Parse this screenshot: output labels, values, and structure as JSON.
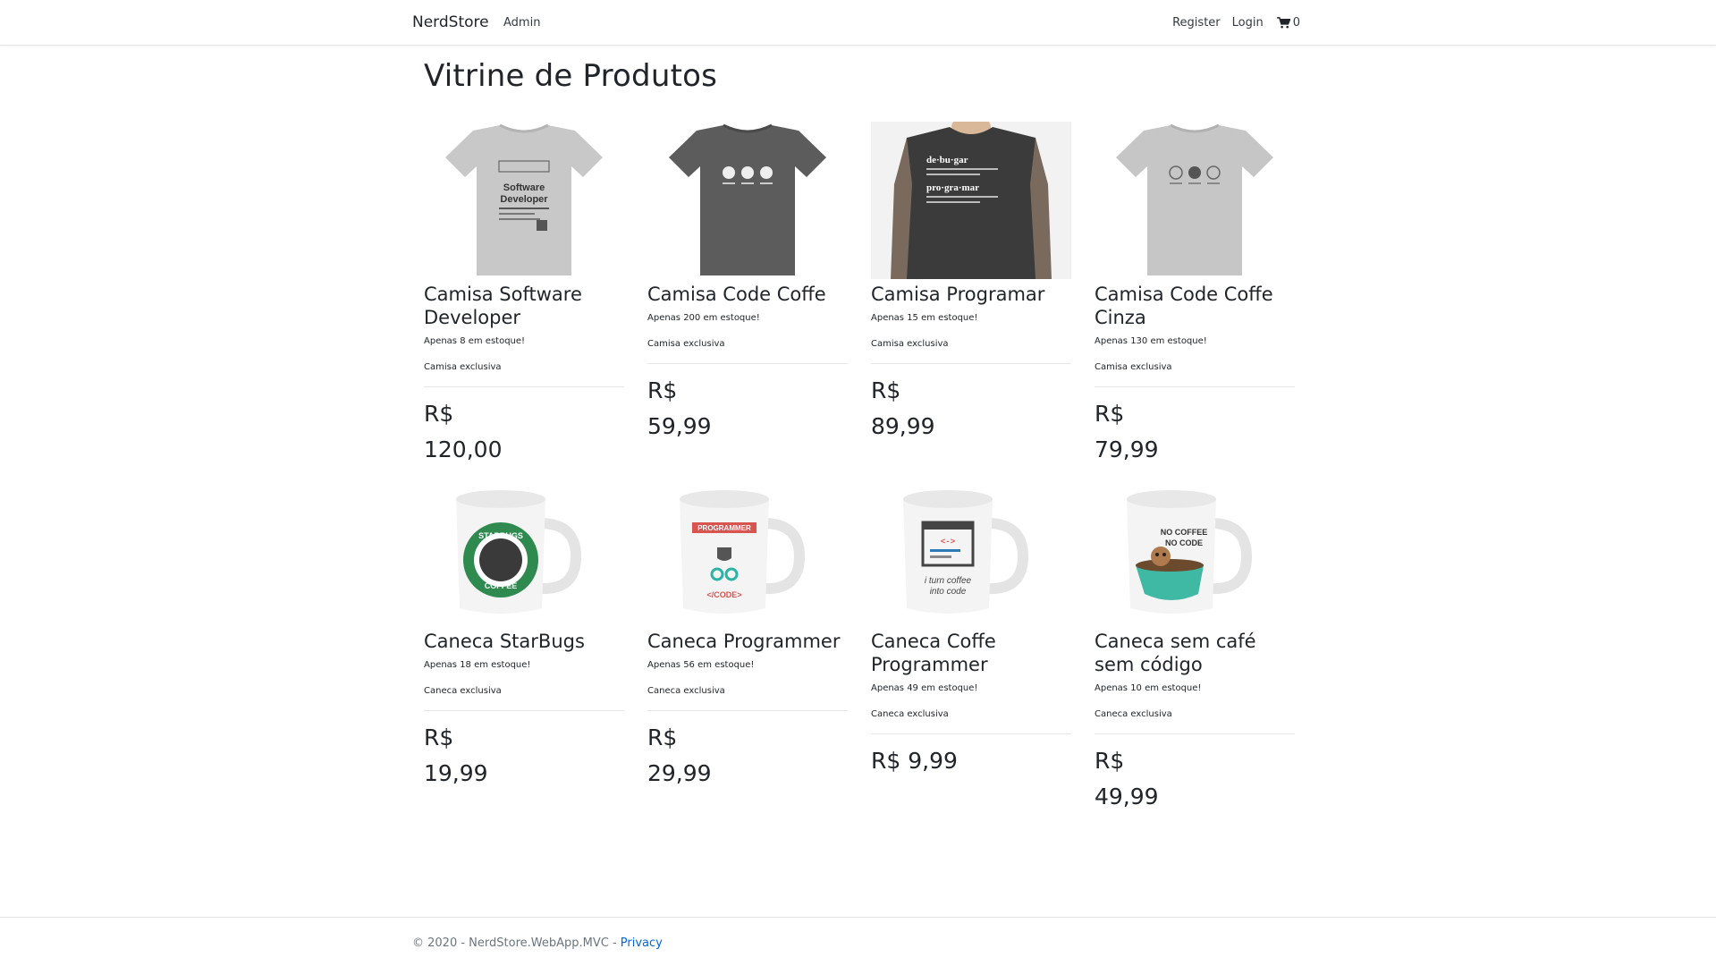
{
  "nav": {
    "brand": "NerdStore",
    "admin": "Admin",
    "register": "Register",
    "login": "Login",
    "cart_count": "0"
  },
  "page_title": "Vitrine de Produtos",
  "products": [
    {
      "name": "Camisa Software Developer",
      "stock": "Apenas 8 em estoque!",
      "desc": "Camisa exclusiva",
      "price": "R$ 120,00",
      "image": "tshirt-software-developer"
    },
    {
      "name": "Camisa Code Coffe",
      "stock": "Apenas 200 em estoque!",
      "desc": "Camisa exclusiva",
      "price": "R$ 59,99",
      "image": "tshirt-code-coffe-dark"
    },
    {
      "name": "Camisa Programar",
      "stock": "Apenas 15 em estoque!",
      "desc": "Camisa exclusiva",
      "price": "R$ 89,99",
      "image": "tshirt-programar"
    },
    {
      "name": "Camisa Code Coffe Cinza",
      "stock": "Apenas 130 em estoque!",
      "desc": "Camisa exclusiva",
      "price": "R$ 79,99",
      "image": "tshirt-code-coffe-grey"
    },
    {
      "name": "Caneca StarBugs",
      "stock": "Apenas 18 em estoque!",
      "desc": "Caneca exclusiva",
      "price": "R$ 19,99",
      "image": "mug-starbugs"
    },
    {
      "name": "Caneca Programmer",
      "stock": "Apenas 56 em estoque!",
      "desc": "Caneca exclusiva",
      "price": "R$ 29,99",
      "image": "mug-programmer"
    },
    {
      "name": "Caneca Coffe Programmer",
      "stock": "Apenas 49 em estoque!",
      "desc": "Caneca exclusiva",
      "price": "R$ 9,99",
      "image": "mug-coffee-programmer"
    },
    {
      "name": "Caneca sem café sem código",
      "stock": "Apenas 10 em estoque!",
      "desc": "Caneca exclusiva",
      "price": "R$ 49,99",
      "image": "mug-no-coffee-no-code"
    }
  ],
  "footer": {
    "copyright": "© 2020 - NerdStore.WebApp.MVC - ",
    "privacy": "Privacy"
  }
}
